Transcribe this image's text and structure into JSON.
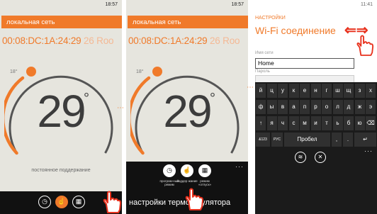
{
  "screen1": {
    "time": "18:57",
    "network_label": "локальная сеть",
    "mac": "00:08:DC:1A:24:29",
    "mac_suffix": "26 Roo",
    "setpoint": "18°",
    "temperature": "29",
    "degree": "°",
    "mode_text": "постоянное поддержание",
    "appbar": [
      "clock-icon",
      "hand-point-icon",
      "calendar-icon"
    ]
  },
  "screen2": {
    "time": "18:57",
    "network_label": "локальная сеть",
    "mac": "00:08:DC:1A:24:29",
    "mac_suffix": "26 Roo",
    "setpoint": "18°",
    "temperature": "29",
    "degree": "°",
    "ellipsis": "···",
    "buttons": [
      {
        "icon": "clock-icon",
        "label": "програм-ный режим"
      },
      {
        "icon": "hand-point-icon",
        "label": "поддер жание"
      },
      {
        "icon": "calendar-icon",
        "label": "режим «отпуск»"
      }
    ],
    "menu_text": "настройки терморегулятора"
  },
  "screen3": {
    "time": "11:41",
    "header": "НАСТРОЙКИ",
    "title": "Wi-Fi соединение",
    "network_name_label": "Имя сети",
    "network_name_value": "Home",
    "password_label": "Пароль",
    "keyboard": {
      "row1": [
        "й",
        "ц",
        "у",
        "к",
        "е",
        "н",
        "г",
        "ш",
        "щ",
        "з",
        "х"
      ],
      "row2": [
        "ф",
        "ы",
        "в",
        "а",
        "п",
        "р",
        "о",
        "л",
        "д",
        "ж",
        "э"
      ],
      "row3": [
        "↑",
        "я",
        "ч",
        "с",
        "м",
        "и",
        "т",
        "ь",
        "б",
        "ю",
        "⌫"
      ],
      "row4": {
        "num": "&123",
        "lang": "РУС",
        "space": "Пробел",
        "comma": ",",
        "dot": ".",
        "enter": "↵"
      }
    },
    "bottom_icons": [
      "wifi-icon",
      "close-icon"
    ],
    "ellipsis": "···"
  },
  "colors": {
    "accent": "#f07a2a",
    "arrow": "#e8321e",
    "background": "#e6e5de",
    "appbar": "#111111"
  }
}
